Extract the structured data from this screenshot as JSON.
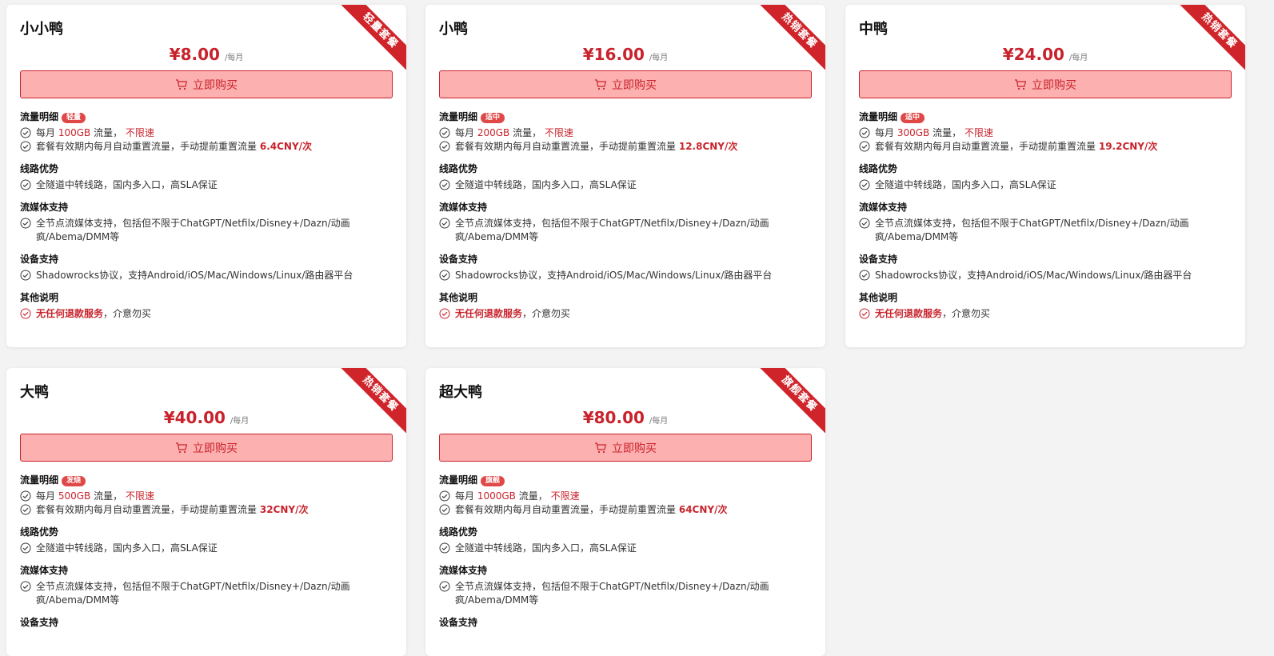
{
  "buy_label": "立即购买",
  "per_label": "/每月",
  "section_titles": {
    "traffic": "流量明细",
    "route": "线路优势",
    "media": "流媒体支持",
    "device": "设备支持",
    "other": "其他说明"
  },
  "common": {
    "month_prefix": "每月",
    "traffic_suffix": "流量，",
    "unlimited": "不限速",
    "reset_text": "套餐有效期内每月自动重置流量，手动提前重置流量",
    "route_text": "全隧道中转线路，国内多入口，高SLA保证",
    "media_text": "全节点流媒体支持，包括但不限于ChatGPT/Netfilx/Disney+/Dazn/动画疯/Abema/DMM等",
    "device_text": "Shadowrocks协议，支持Android/iOS/Mac/Windows/Linux/路由器平台",
    "refund_hl": "无任何退款服务",
    "refund_tail": "，介意勿买"
  },
  "plans": [
    {
      "name": "小小鸭",
      "price": "¥8.00",
      "ribbon": "轻量套餐",
      "tag": "轻量",
      "traffic": "100GB",
      "reset_price": "6.4CNY/次"
    },
    {
      "name": "小鸭",
      "price": "¥16.00",
      "ribbon": "热销套餐",
      "tag": "适中",
      "traffic": "200GB",
      "reset_price": "12.8CNY/次"
    },
    {
      "name": "中鸭",
      "price": "¥24.00",
      "ribbon": "热销套餐",
      "tag": "适中",
      "traffic": "300GB",
      "reset_price": "19.2CNY/次"
    },
    {
      "name": "大鸭",
      "price": "¥40.00",
      "ribbon": "热销套餐",
      "tag": "发烧",
      "traffic": "500GB",
      "reset_price": "32CNY/次"
    },
    {
      "name": "超大鸭",
      "price": "¥80.00",
      "ribbon": "旗舰套餐",
      "tag": "旗舰",
      "traffic": "1000GB",
      "reset_price": "64CNY/次"
    }
  ]
}
